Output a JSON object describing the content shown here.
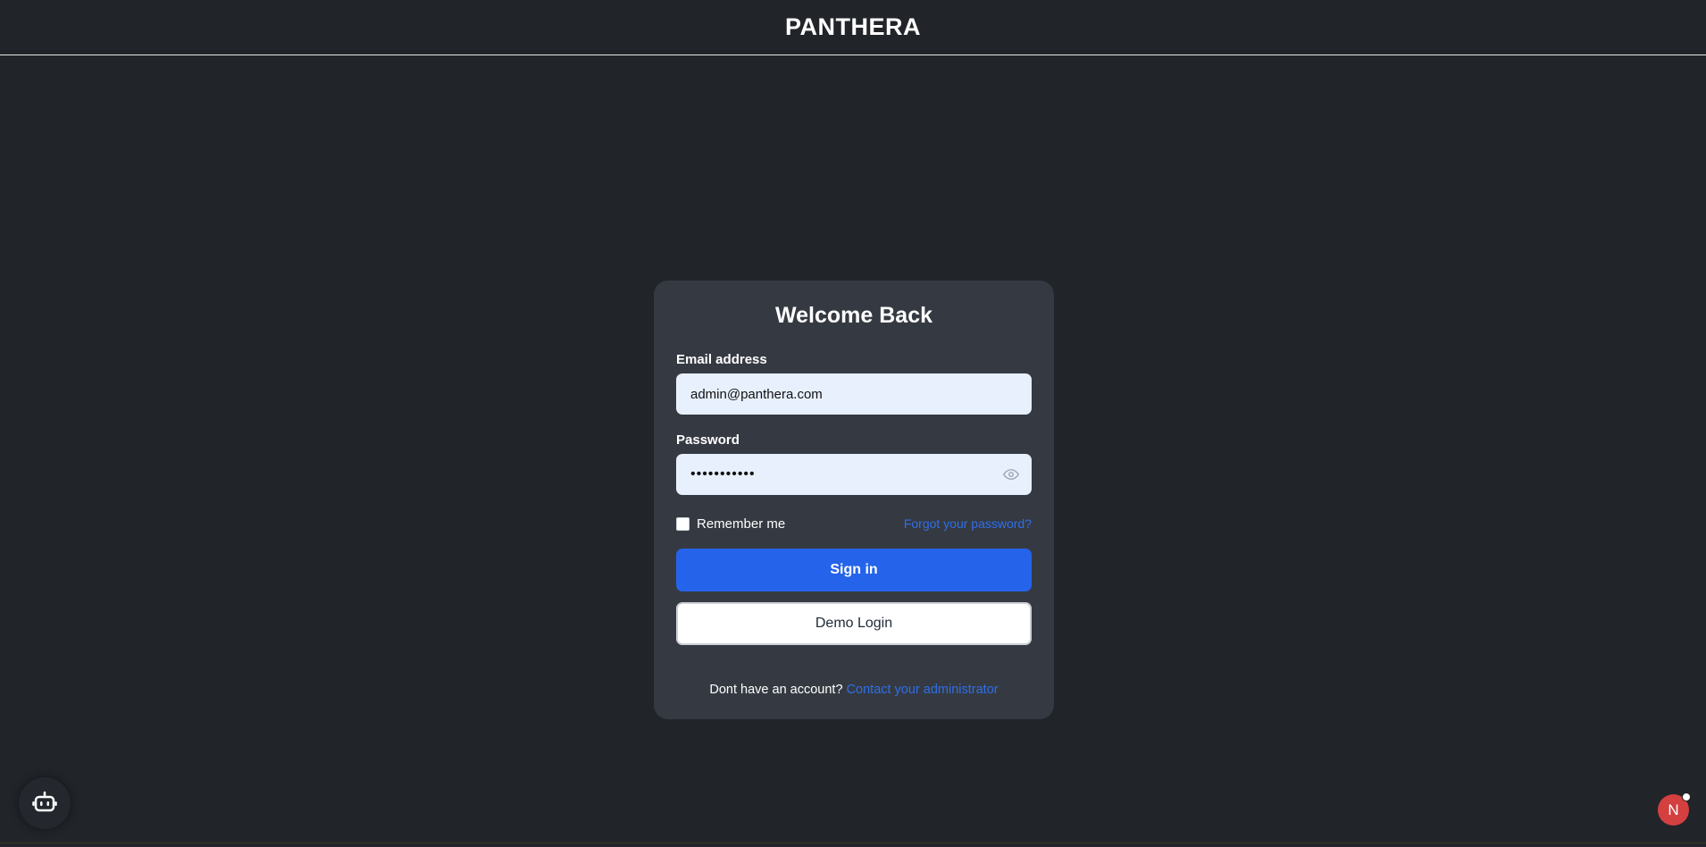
{
  "header": {
    "brand": "PANTHERA"
  },
  "login": {
    "title": "Welcome Back",
    "email_label": "Email address",
    "email_value": "admin@panthera.com",
    "password_label": "Password",
    "password_value": "•••••••••••",
    "remember_label": "Remember me",
    "forgot_link": "Forgot your password?",
    "signin_label": "Sign in",
    "demo_label": "Demo Login",
    "signup_prompt": "Dont have an account?",
    "signup_link": "Contact your administrator"
  },
  "icons": {
    "assistant": "robot-icon",
    "password_toggle": "eye-icon"
  },
  "user": {
    "avatar_initial": "N"
  },
  "colors": {
    "background": "#212429",
    "card": "#353a42",
    "primary": "#2563eb",
    "link": "#2f6ee7",
    "input": "#e8f0fe",
    "avatar": "#d43f3f"
  }
}
